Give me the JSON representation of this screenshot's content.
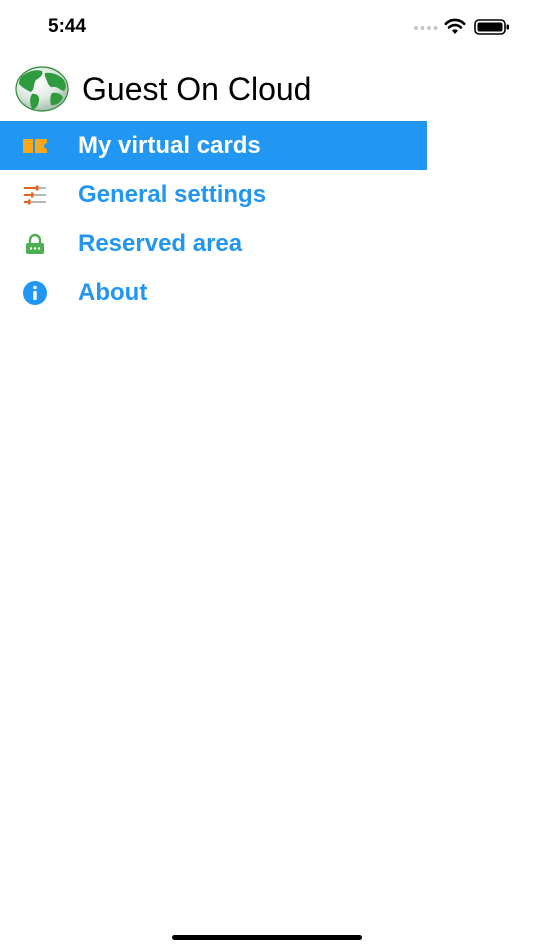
{
  "status_bar": {
    "time": "5:44",
    "icons": [
      "signal-dots-icon",
      "wifi-icon",
      "battery-icon"
    ]
  },
  "header": {
    "title": "Guest On Cloud",
    "logo_icon": "globe-icon"
  },
  "menu": {
    "items": [
      {
        "label": "My virtual cards",
        "icon": "ticket-icon",
        "active": true
      },
      {
        "label": "General settings",
        "icon": "sliders-icon",
        "active": false
      },
      {
        "label": "Reserved area",
        "icon": "lock-icon",
        "active": false
      },
      {
        "label": "About",
        "icon": "info-icon",
        "active": false
      }
    ]
  },
  "colors": {
    "accent": "#2196f3",
    "active_text": "#ffffff",
    "ticket_icon": "#f7a81b",
    "sliders_icon": "#e8601c",
    "lock_icon": "#4caf50",
    "info_icon": "#2196f3"
  }
}
